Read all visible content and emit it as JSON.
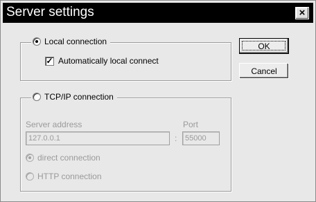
{
  "window": {
    "title": "Server settings",
    "close_glyph": "×"
  },
  "local_group": {
    "label": "Local connection",
    "selected": true,
    "auto_connect": {
      "label": "Automatically local connect",
      "checked": true,
      "check_glyph": "✓"
    }
  },
  "tcp_group": {
    "label": "TCP/IP connection",
    "selected": false,
    "server_address_label": "Server address",
    "server_address_value": "127.0.0.1",
    "port_label": "Port",
    "port_value": "55000",
    "separator": ":",
    "direct_connection": {
      "label": "direct connection",
      "selected": true
    },
    "http_connection": {
      "label": "HTTP connection",
      "selected": false
    }
  },
  "buttons": {
    "ok": "OK",
    "cancel": "Cancel"
  },
  "colors": {
    "title_bar": "#000000",
    "dialog_bg": "#e8e8e8",
    "disabled_text": "#9a9a9a"
  }
}
